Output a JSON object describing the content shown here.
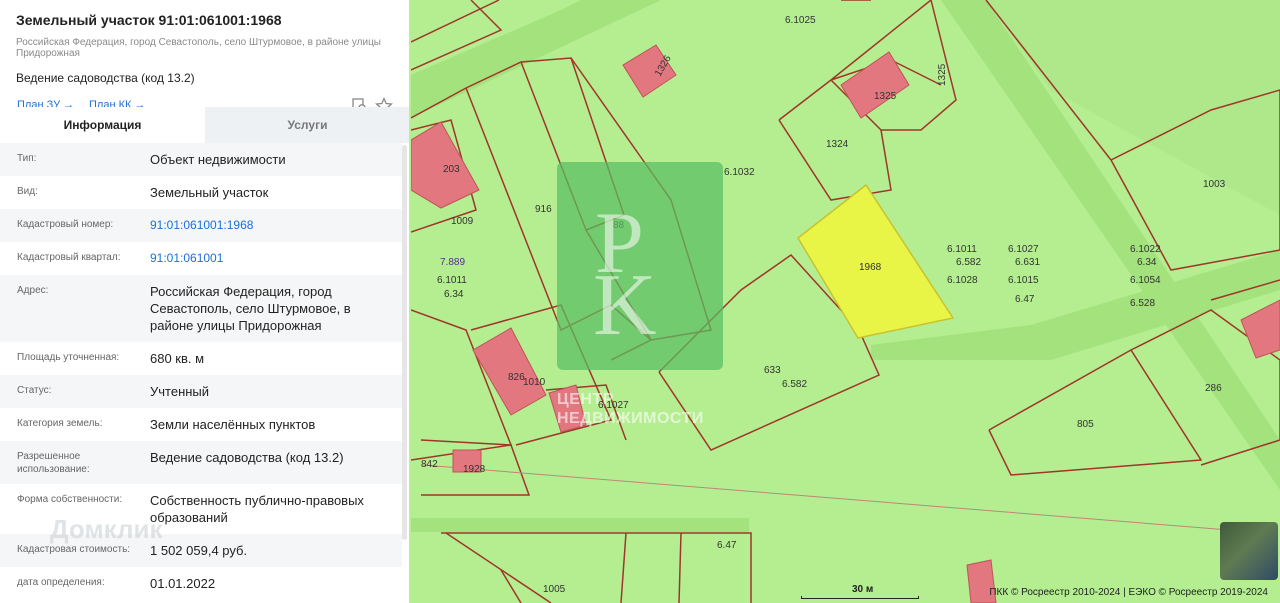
{
  "parcel": {
    "title": "Земельный участок 91:01:061001:1968",
    "address": "Российская Федерация, город Севастополь, село Штурмовое, в районе улицы Придорожная",
    "purpose": "Ведение садоводства (код 13.2)",
    "link_plan_zu": "План ЗУ",
    "link_plan_kk": "План КК"
  },
  "tabs": [
    "Информация",
    "Услуги"
  ],
  "info_rows": [
    {
      "key": "Тип:",
      "value": "Объект недвижимости"
    },
    {
      "key": "Вид:",
      "value": "Земельный участок"
    },
    {
      "key": "Кадастровый номер:",
      "value": "91:01:061001:1968"
    },
    {
      "key": "Кадастровый квартал:",
      "value": "91:01:061001"
    },
    {
      "key": "Адрес:",
      "value": "Российская Федерация, город Севастополь, село Штурмовое, в районе улицы Придорожная"
    },
    {
      "key": "Площадь уточненная:",
      "value": "680 кв. м"
    },
    {
      "key": "Статус:",
      "value": "Учтенный"
    },
    {
      "key": "Категория земель:",
      "value": "Земли населённых пунктов"
    },
    {
      "key": "Разрешенное использование:",
      "value": "Ведение садоводства (код 13.2)"
    },
    {
      "key": "Форма собственности:",
      "value": "Собственность публично-правовых образований"
    },
    {
      "key": "Кадастровая стоимость:",
      "value": "1 502 059,4 руб."
    },
    {
      "key": "дата определения:",
      "value": "01.01.2022"
    }
  ],
  "watermark_logo": "Домклик",
  "map": {
    "parcel_labels": [
      "1968",
      "1324",
      "1325",
      "1003",
      "916",
      "88",
      "1009",
      "203",
      "826",
      "1010",
      "633",
      "286",
      "805",
      "842",
      "1928",
      "1005",
      "6.1025",
      "6.1032",
      "6.1011",
      "6.582",
      "6.1028",
      "6.1027",
      "6.631",
      "6.1015",
      "6.47",
      "6.1022",
      "6.34",
      "6.1054",
      "6.528",
      "7.889",
      "6.1011",
      "6.34",
      "6.582",
      "6.1027",
      "6.47",
      "1325",
      "1326"
    ],
    "watermark_text_line1": "ЦЕНТР",
    "watermark_text_line2": "НЕДВИЖИМОСТИ",
    "scale": "30 м",
    "attribution": "ПКК © Росреестр 2010-2024 | ЕЭКО © Росреестр 2019-2024",
    "colors": {
      "land": "#b4ee90",
      "road": "#a3e27c",
      "boundary": "#a0352a",
      "building": "#e2777f",
      "selected": "#e8f547"
    }
  }
}
